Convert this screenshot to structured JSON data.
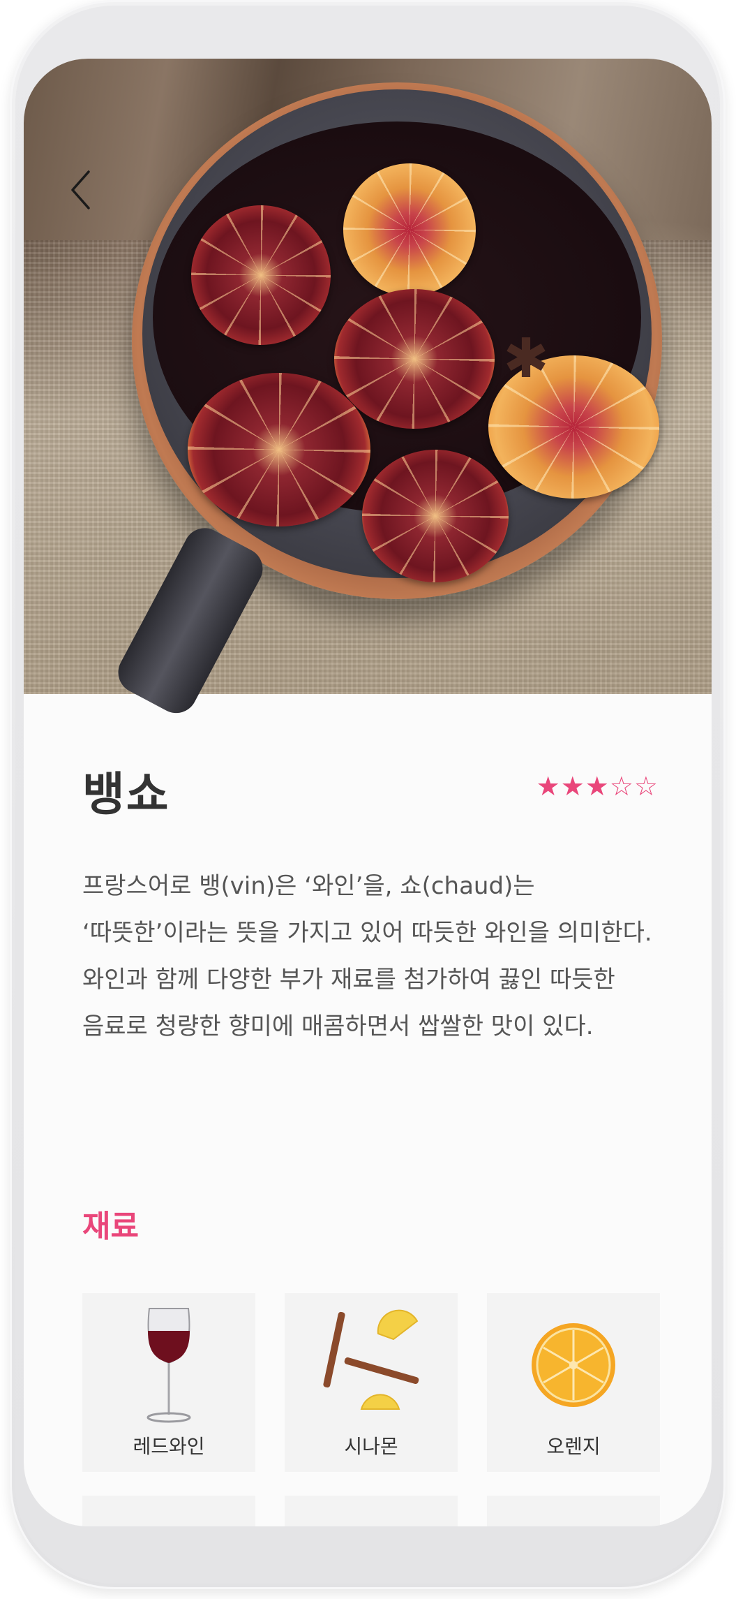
{
  "header": {
    "back_icon": "chevron-left-icon"
  },
  "drink": {
    "name": "뱅쇼",
    "rating": 3,
    "rating_max": 5,
    "rating_filled": "★★★",
    "rating_empty": "☆☆",
    "description": "프랑스어로 뱅(vin)은 ‘와인’을, 쇼(chaud)는 ‘따뜻한’이라는 뜻을 가지고 있어 따듯한 와인을 의미한다. 와인과 함께 다양한 부가 재료를 첨가하여 끓인 따듯한 음료로 청량한 향미에 매콤하면서 쌉쌀한 맛이 있다."
  },
  "ingredients": {
    "section_title": "재료",
    "items": [
      {
        "label": "레드와인",
        "icon": "red-wine-glass-icon"
      },
      {
        "label": "시나몬",
        "icon": "cinnamon-lemon-icon"
      },
      {
        "label": "오렌지",
        "icon": "orange-slice-icon"
      }
    ]
  },
  "colors": {
    "accent": "#e9467a",
    "title": "#333333",
    "body_text": "#555555",
    "card_bg": "#f3f3f3"
  }
}
